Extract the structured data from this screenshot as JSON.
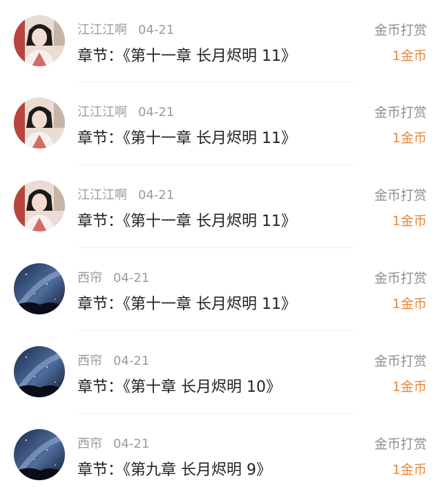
{
  "rows": [
    {
      "avatar": "avatar-woman-portrait",
      "user": "江江江啊",
      "date": "04-21",
      "chapter": "章节：《第十一章 长月烬明 11》",
      "tip_label": "金币打赏",
      "tip_amount": "1金币"
    },
    {
      "avatar": "avatar-woman-portrait",
      "user": "江江江啊",
      "date": "04-21",
      "chapter": "章节：《第十一章 长月烬明 11》",
      "tip_label": "金币打赏",
      "tip_amount": "1金币"
    },
    {
      "avatar": "avatar-woman-portrait",
      "user": "江江江啊",
      "date": "04-21",
      "chapter": "章节：《第十一章 长月烬明 11》",
      "tip_label": "金币打赏",
      "tip_amount": "1金币"
    },
    {
      "avatar": "avatar-night-sky",
      "user": "西帘",
      "date": "04-21",
      "chapter": "章节：《第十一章 长月烬明 11》",
      "tip_label": "金币打赏",
      "tip_amount": "1金币"
    },
    {
      "avatar": "avatar-night-sky",
      "user": "西帘",
      "date": "04-21",
      "chapter": "章节：《第十章 长月烬明 10》",
      "tip_label": "金币打赏",
      "tip_amount": "1金币"
    },
    {
      "avatar": "avatar-night-sky",
      "user": "西帘",
      "date": "04-21",
      "chapter": "章节：《第九章 长月烬明 9》",
      "tip_label": "金币打赏",
      "tip_amount": "1金币"
    }
  ],
  "colors": {
    "accent": "#e8873b",
    "meta": "#9a9a9a",
    "text": "#222222"
  }
}
